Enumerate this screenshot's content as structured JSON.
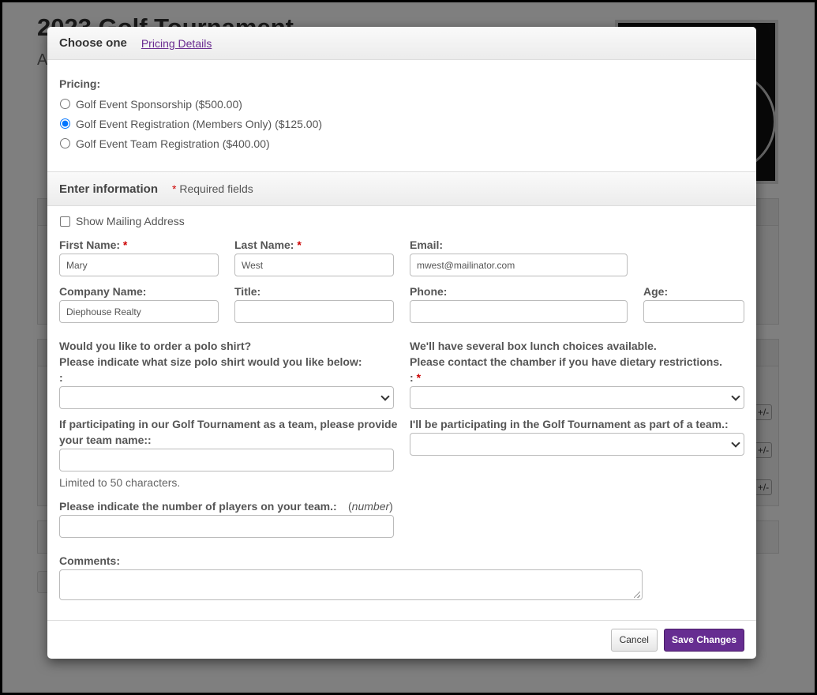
{
  "background": {
    "title": "2023 Golf Tournament",
    "subtitle": "A",
    "side_buttons": [
      "+/-",
      "+/-",
      "+/-"
    ]
  },
  "modal": {
    "header": {
      "title": "Choose one",
      "link": "Pricing Details"
    },
    "pricing": {
      "label": "Pricing:",
      "options": [
        {
          "label": "Golf Event Sponsorship ($500.00)",
          "selected": false
        },
        {
          "label": "Golf Event Registration (Members Only) ($125.00)",
          "selected": true
        },
        {
          "label": "Golf Event Team Registration ($400.00)",
          "selected": false
        }
      ]
    },
    "info_section": {
      "title": "Enter information",
      "required_star": "*",
      "required_note": "Required fields"
    },
    "form": {
      "show_mailing_address": "Show Mailing Address",
      "first_name": {
        "label": "First Name:",
        "value": "Mary"
      },
      "last_name": {
        "label": "Last Name:",
        "value": "West"
      },
      "email": {
        "label": "Email:",
        "value": "mwest@mailinator.com"
      },
      "company": {
        "label": "Company Name:",
        "value": "Diephouse Realty"
      },
      "title": {
        "label": "Title:",
        "value": ""
      },
      "phone": {
        "label": "Phone:",
        "value": ""
      },
      "age": {
        "label": "Age:",
        "value": ""
      },
      "polo": {
        "line1": "Would you like to order a polo shirt?",
        "line2": "Please indicate what size polo shirt would you like below:",
        "line3": ":"
      },
      "lunch": {
        "line1": "We'll have several box lunch choices available.",
        "line2": "Please contact the chamber if you have dietary restrictions.",
        "line3": ":"
      },
      "team_name": {
        "line1": "If participating in our Golf Tournament as a team, please provide",
        "line2": "your team name::",
        "hint": "Limited to 50 characters."
      },
      "team_participation": {
        "label": "I'll be participating in the Golf Tournament as part of a team.:"
      },
      "players": {
        "label": "Please indicate the number of players on your team.:",
        "hint_open": "(",
        "hint": "number",
        "hint_close": ")"
      },
      "comments": {
        "label": "Comments:"
      }
    },
    "footer": {
      "cancel": "Cancel",
      "save": "Save Changes"
    }
  }
}
